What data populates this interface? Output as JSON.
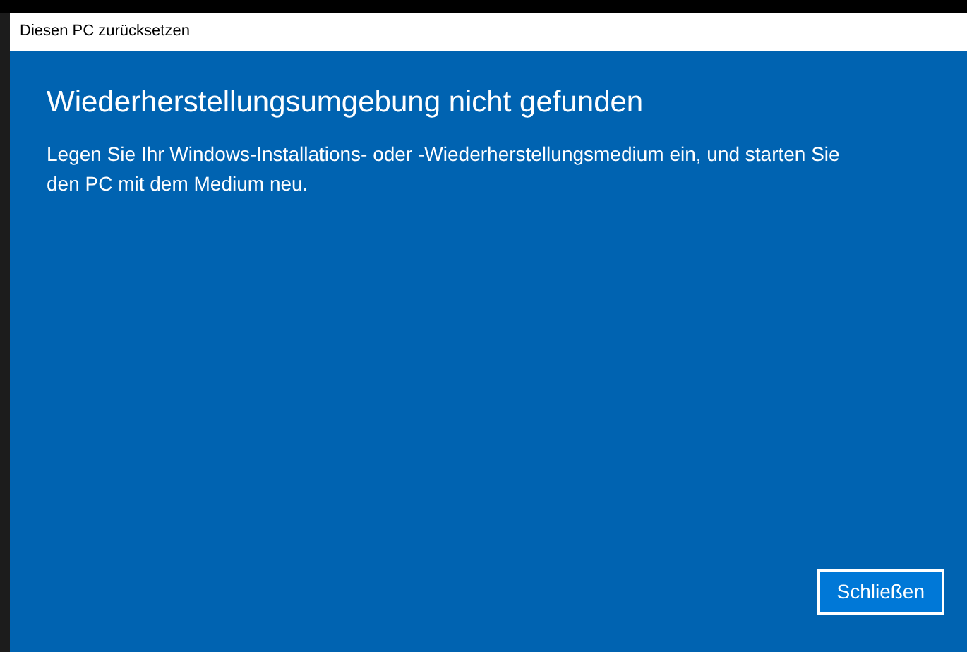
{
  "window": {
    "title": "Diesen PC zurücksetzen"
  },
  "dialog": {
    "heading": "Wiederherstellungsumgebung nicht gefunden",
    "message": "Legen Sie Ihr Windows-Installations- oder -Wiederherstellungsmedium ein, und starten Sie den PC mit dem Medium neu.",
    "buttons": [
      {
        "label": "Schließen",
        "focused": true
      }
    ]
  }
}
